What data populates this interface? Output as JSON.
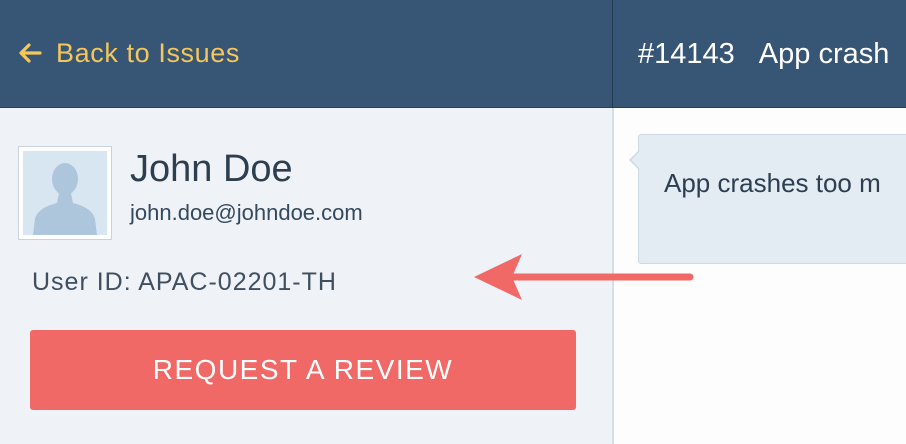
{
  "header": {
    "back_label": "Back to Issues",
    "issue_number": "#14143",
    "issue_title": "App crash"
  },
  "user": {
    "name": "John Doe",
    "email": "john.doe@johndoe.com",
    "user_id": "User ID: APAC-02201-TH",
    "avatar_icon": "user-silhouette-icon"
  },
  "actions": {
    "review_label": "REQUEST A REVIEW"
  },
  "message": {
    "text": "App crashes too m"
  },
  "annotation": {
    "icon": "arrow-left-icon"
  },
  "colors": {
    "header_bg": "#375676",
    "back_link": "#f5c65a",
    "panel_bg": "#eff2f6",
    "review_button": "#f16966",
    "annotation_arrow": "#f16966",
    "message_bg": "#e3ebf3"
  }
}
